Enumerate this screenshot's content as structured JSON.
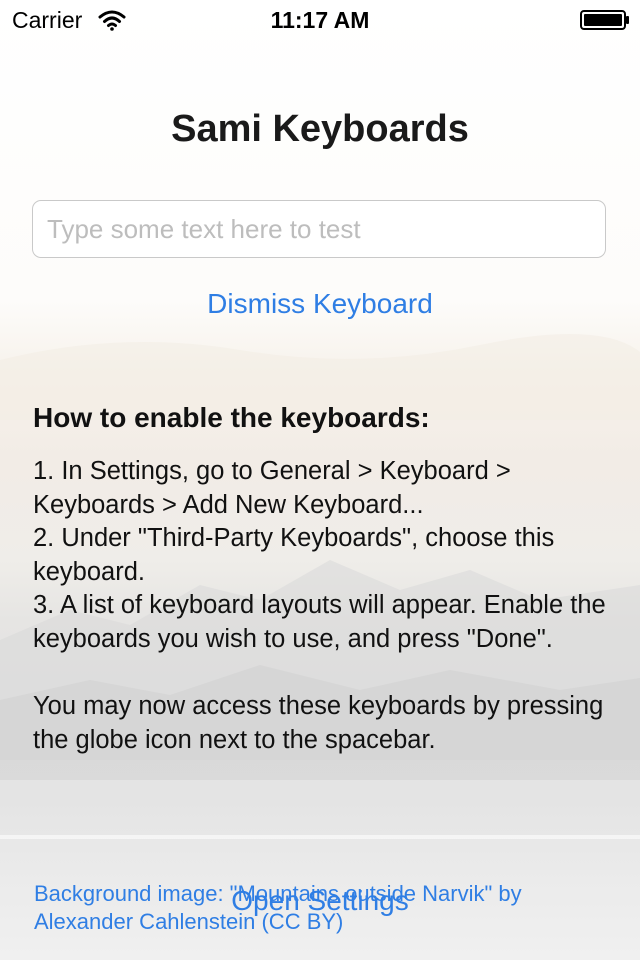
{
  "status_bar": {
    "carrier": "Carrier",
    "time": "11:17 AM"
  },
  "title": "Sami Keyboards",
  "test_input": {
    "value": "",
    "placeholder": "Type some text here to test"
  },
  "dismiss_button_label": "Dismiss Keyboard",
  "instructions": {
    "heading": "How to enable the keyboards:",
    "steps": [
      "1. In Settings, go to General > Keyboard > Keyboards > Add New Keyboard...",
      "2. Under \"Third-Party Keyboards\", choose this keyboard.",
      "3. A list of keyboard layouts will appear. Enable the keyboards you wish to use, and press \"Done\"."
    ],
    "note": "You may now access these keyboards by pressing the globe icon next to the spacebar."
  },
  "open_settings_label": "Open Settings",
  "credit_text": "Background image: \"Mountains outside Narvik\" by Alexander Cahlenstein (CC BY)",
  "colors": {
    "accent": "#2f7ee4",
    "text": "#111111",
    "placeholder": "#bdbdbd"
  },
  "icons": [
    "wifi-icon",
    "battery-icon"
  ]
}
